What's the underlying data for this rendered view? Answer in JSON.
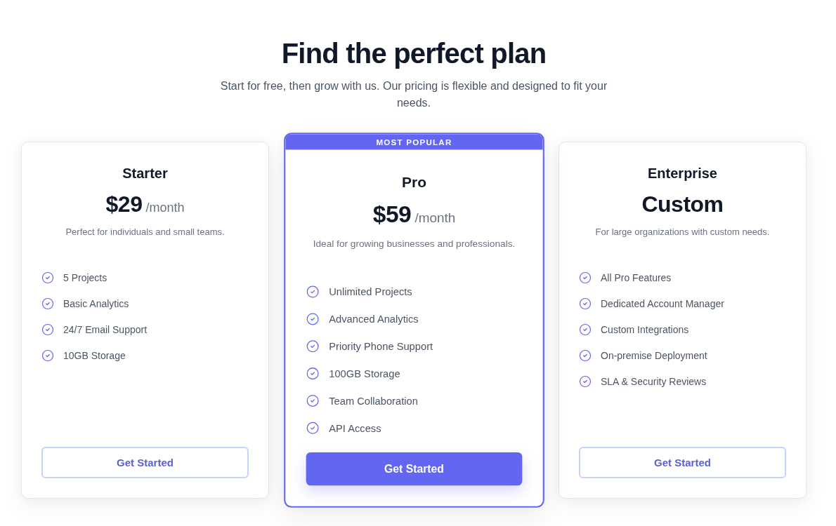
{
  "heading": "Find the perfect plan",
  "subheading": "Start for free, then grow with us. Our pricing is flexible and designed to fit your needs.",
  "plans": [
    {
      "name": "Starter",
      "price": "$29",
      "period": "/month",
      "description": "Perfect for individuals and small teams.",
      "features": [
        "5 Projects",
        "Basic Analytics",
        "24/7 Email Support",
        "10GB Storage"
      ],
      "button": "Get Started",
      "featured": false
    },
    {
      "badge": "MOST POPULAR",
      "name": "Pro",
      "price": "$59",
      "period": "/month",
      "description": "Ideal for growing businesses and professionals.",
      "features": [
        "Unlimited Projects",
        "Advanced Analytics",
        "Priority Phone Support",
        "100GB Storage",
        "Team Collaboration",
        "API Access"
      ],
      "button": "Get Started",
      "featured": true
    },
    {
      "name": "Enterprise",
      "price": "Custom",
      "description": "For large organizations with custom needs.",
      "features": [
        "All Pro Features",
        "Dedicated Account Manager",
        "Custom Integrations",
        "On-premise Deployment",
        "SLA & Security Reviews"
      ],
      "button": "Get Started",
      "featured": false
    }
  ]
}
